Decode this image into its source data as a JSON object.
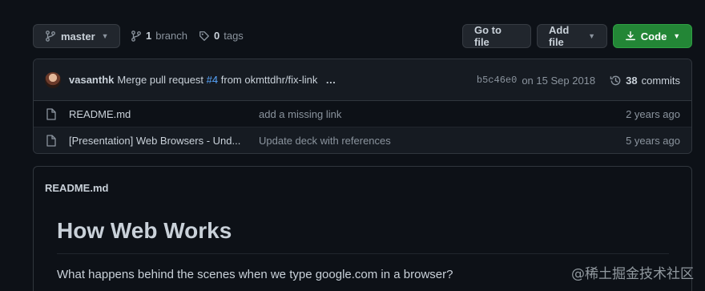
{
  "toolbar": {
    "branch_name": "master",
    "branch_count": "1",
    "branch_word": "branch",
    "tag_count": "0",
    "tag_word": "tags",
    "goto_file": "Go to file",
    "add_file": "Add file",
    "code": "Code"
  },
  "commit": {
    "author": "vasanthk",
    "message_prefix": "Merge pull request",
    "pr_number": "#4",
    "message_suffix": "from okmttdhr/fix-link",
    "ellipsis": "…",
    "sha": "b5c46e0",
    "date": "on 15 Sep 2018",
    "commit_count": "38",
    "commit_word": "commits"
  },
  "files": [
    {
      "name": "README.md",
      "message": "add a missing link",
      "age": "2 years ago"
    },
    {
      "name": "[Presentation] Web Browsers - Und...",
      "message": "Update deck with references",
      "age": "5 years ago"
    }
  ],
  "readme": {
    "label": "README.md",
    "title": "How Web Works",
    "intro": "What happens behind the scenes when we type google.com in a browser?"
  },
  "watermark": "@稀土掘金技术社区",
  "colors": {
    "background": "#0d1117",
    "code_button": "#238636",
    "link": "#58a6ff"
  }
}
